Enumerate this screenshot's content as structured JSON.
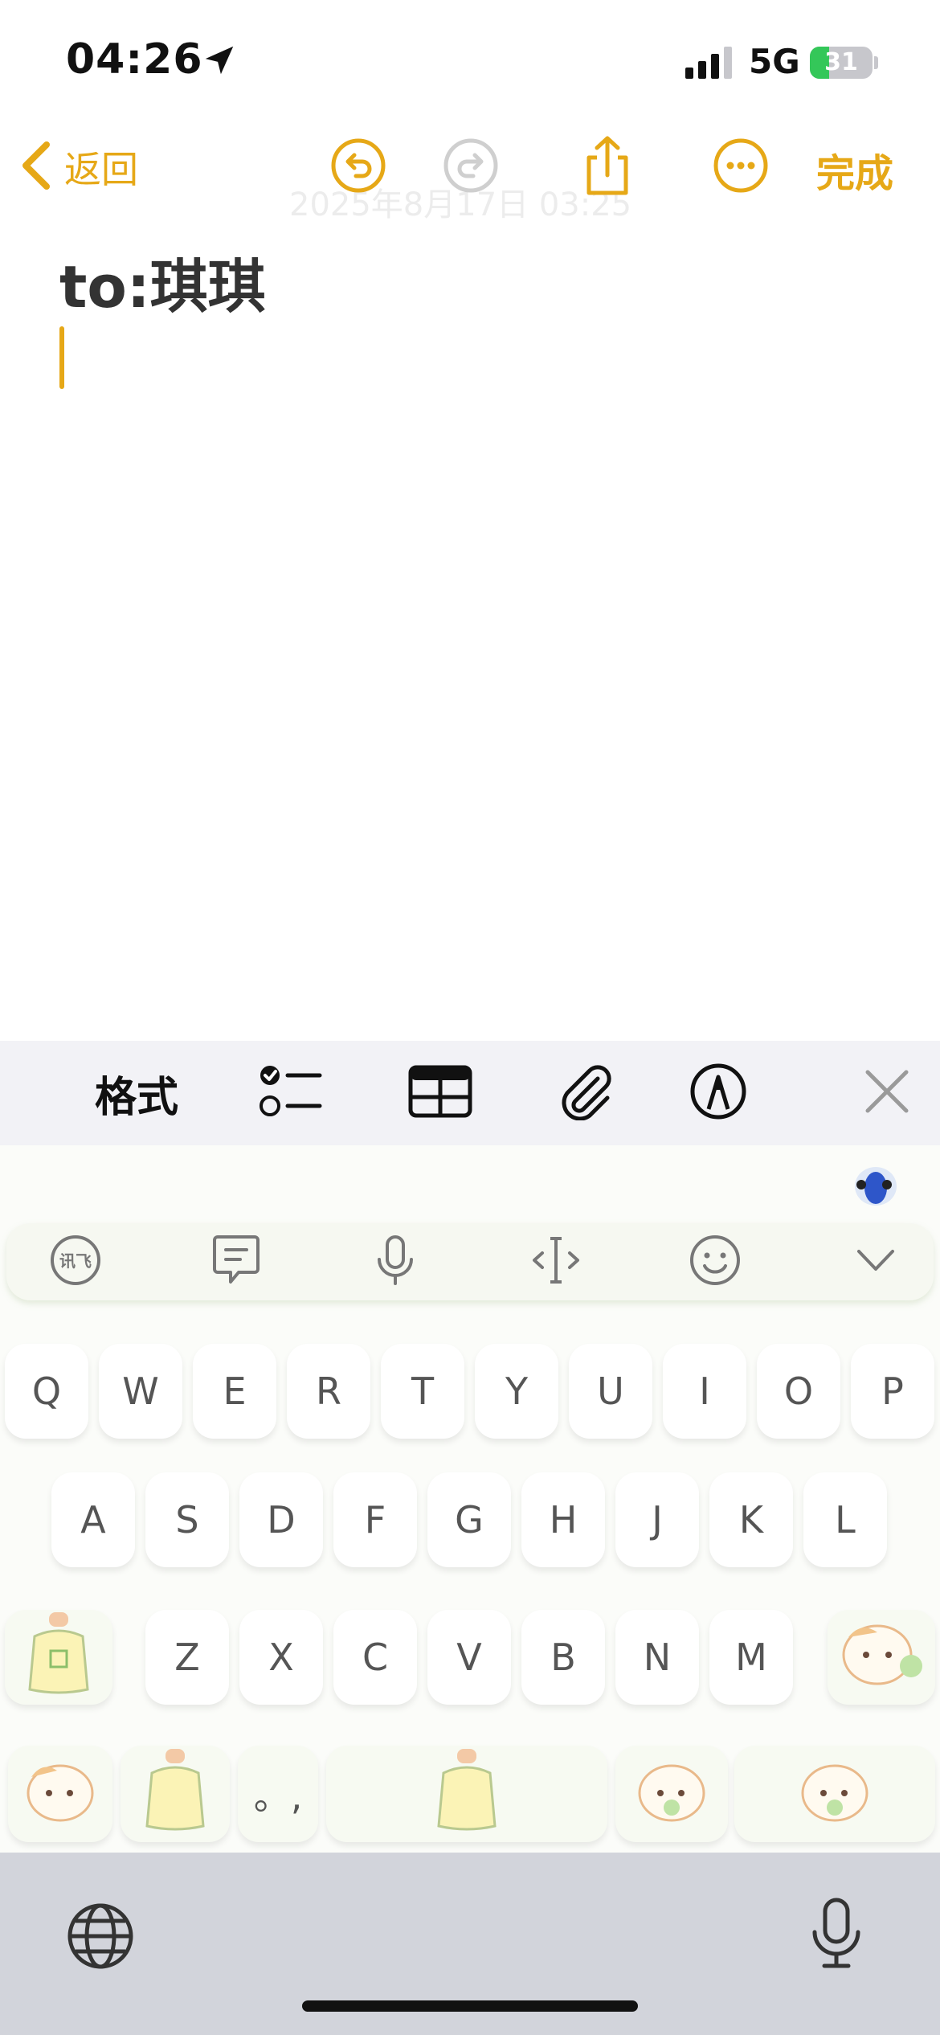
{
  "status_bar": {
    "time": "04:26",
    "network": "5G",
    "battery": "31",
    "battery_level": 0.31,
    "icons": [
      "location-arrow-icon",
      "cellular-signal-icon",
      "battery-charging-icon"
    ]
  },
  "nav": {
    "back_label": "返回",
    "done_label": "完成",
    "faded_date": "2025年8月17日 03:25",
    "icons": [
      "chevron-left-icon",
      "undo-icon",
      "redo-icon",
      "share-icon",
      "more-icon"
    ],
    "accent_color": "#e6a817"
  },
  "note": {
    "title": "to:琪琪"
  },
  "format_toolbar": {
    "format_label": "格式",
    "icons": [
      "checklist-icon",
      "table-icon",
      "paperclip-icon",
      "markup-pen-icon",
      "close-icon"
    ]
  },
  "keyboard": {
    "toolbar_icons": [
      "xunfei-logo-icon",
      "text-message-icon",
      "voice-mic-icon",
      "cursor-move-icon",
      "emoji-icon",
      "collapse-chevron-icon"
    ],
    "row1": [
      "Q",
      "W",
      "E",
      "R",
      "T",
      "Y",
      "U",
      "I",
      "O",
      "P"
    ],
    "row2": [
      "A",
      "S",
      "D",
      "F",
      "G",
      "H",
      "J",
      "K",
      "L"
    ],
    "row3": [
      "Z",
      "X",
      "C",
      "V",
      "B",
      "N",
      "M"
    ],
    "punct_key": "。,",
    "mascot_icons": [
      "shiba-mascot-icon",
      "lucky-bag-icon"
    ]
  },
  "bottom_bar": {
    "icons": [
      "globe-icon",
      "dictation-mic-icon"
    ]
  }
}
